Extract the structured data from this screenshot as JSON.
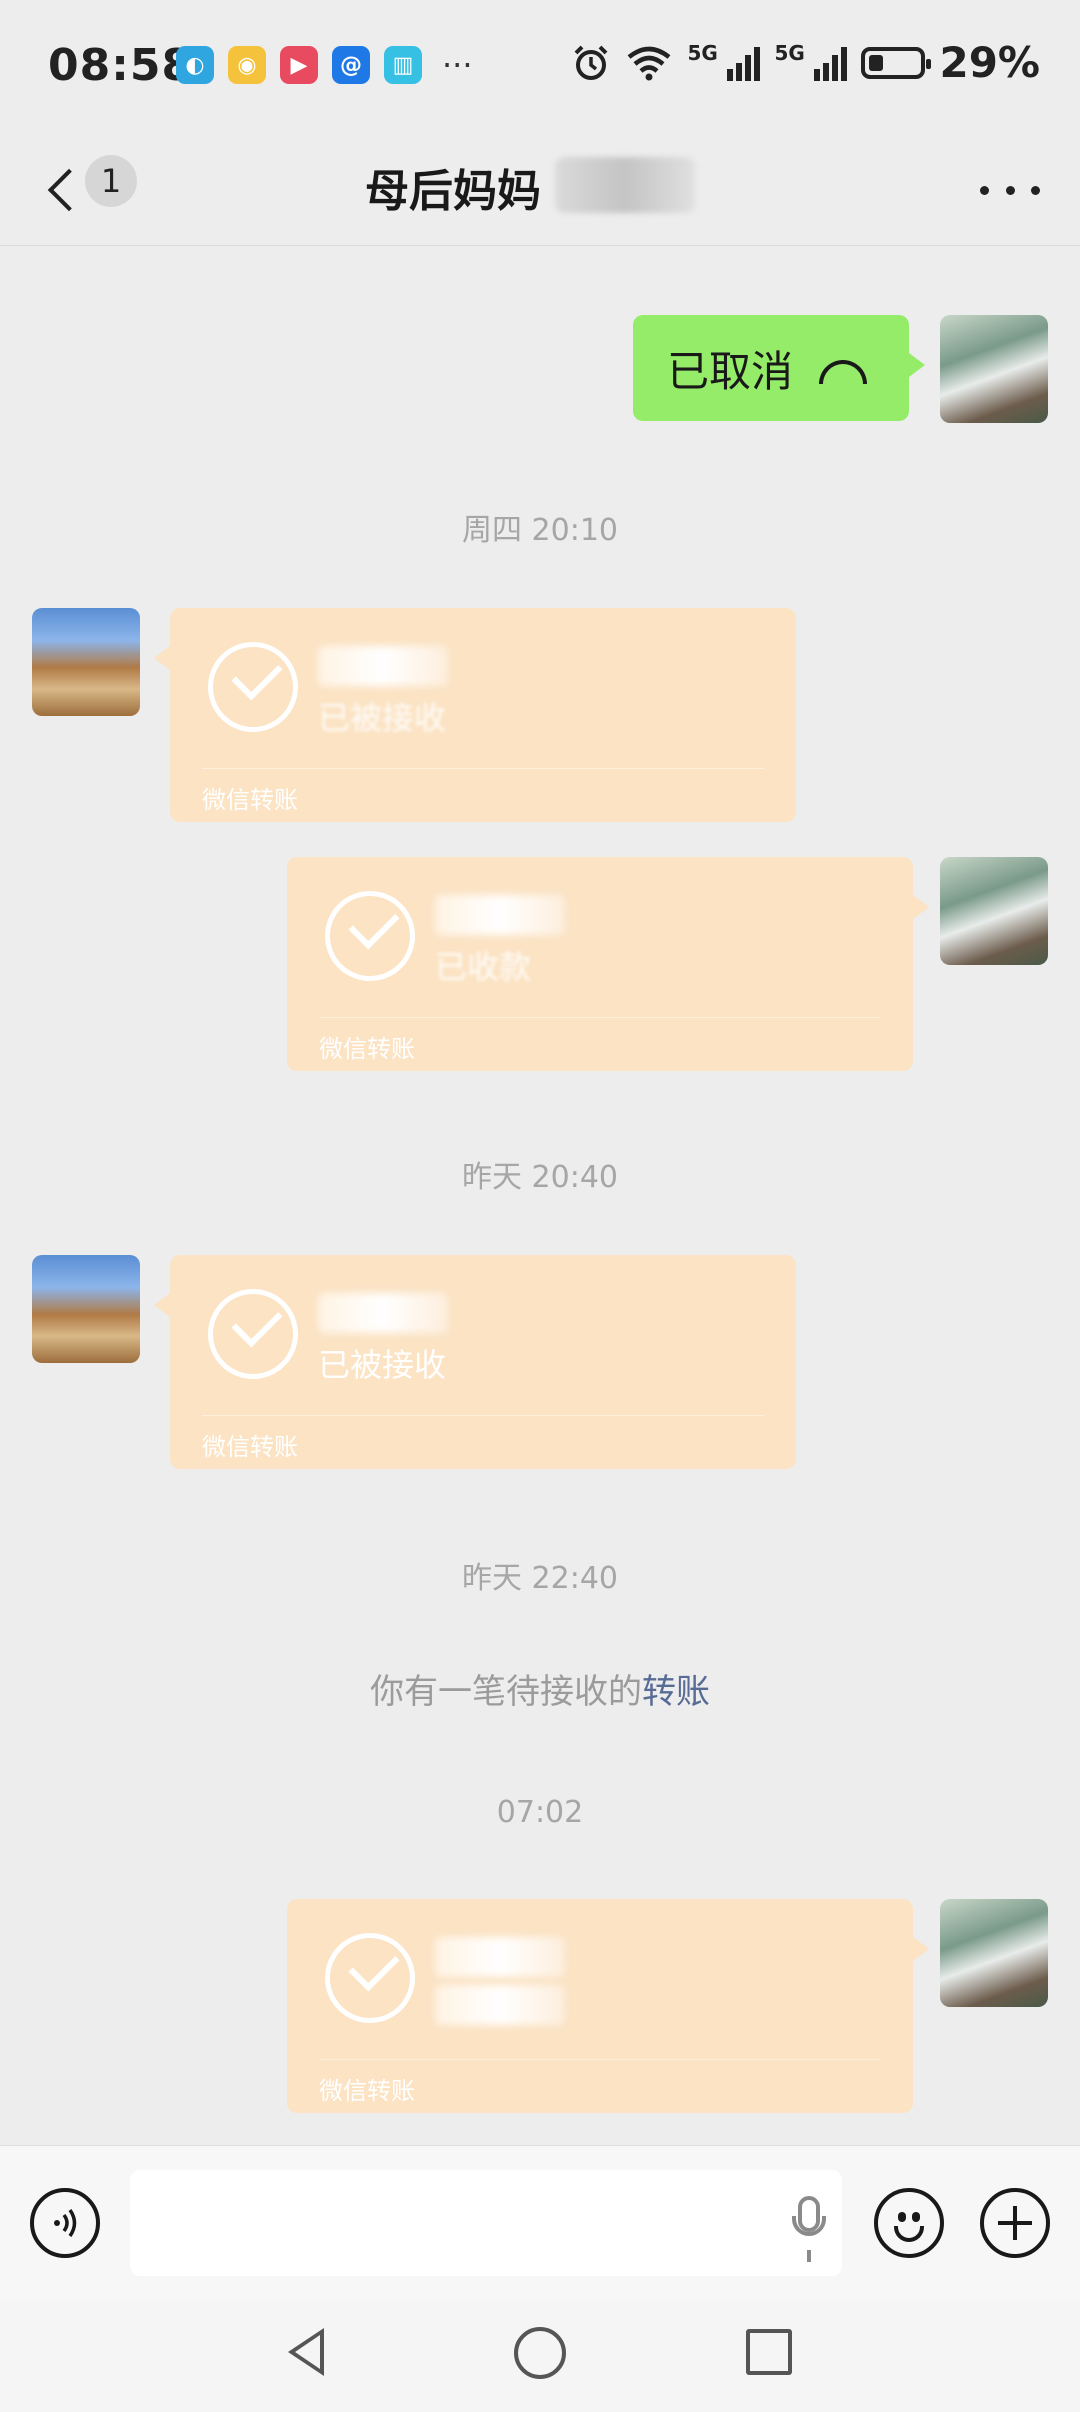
{
  "status_bar": {
    "time": "08:58",
    "battery": "29%",
    "battery_level": 0.29,
    "network": [
      "5G",
      "5G"
    ],
    "more_notifications": "···",
    "app_icons": [
      "app-icon",
      "weibo-icon",
      "video-icon",
      "browser-icon",
      "book-icon"
    ]
  },
  "header": {
    "back_badge": "1",
    "title": "母后妈妈"
  },
  "messages": {
    "call": {
      "text": "已取消"
    },
    "ts1": "周四 20:10",
    "transfer1": {
      "status": "已被接收",
      "footer": "微信转账"
    },
    "transfer2": {
      "status": "已收款",
      "footer": "微信转账"
    },
    "ts2": "昨天 20:40",
    "transfer3": {
      "status": "已被接收",
      "footer": "微信转账"
    },
    "ts3": "昨天 22:40",
    "system": {
      "text": "你有一笔待接收的",
      "link": "转账"
    },
    "ts4": "07:02",
    "transfer4": {
      "status": "",
      "footer": "微信转账"
    }
  },
  "input_bar": {
    "voice_icon": "voice-icon",
    "emoji_icon": "emoji-icon",
    "plus_icon": "plus-icon",
    "mic_icon": "mic-icon",
    "placeholder": ""
  },
  "colors": {
    "background": "#ededed",
    "sent_bubble": "#95ec69",
    "transfer_card": "#fbe3c4",
    "link": "#576b95"
  }
}
